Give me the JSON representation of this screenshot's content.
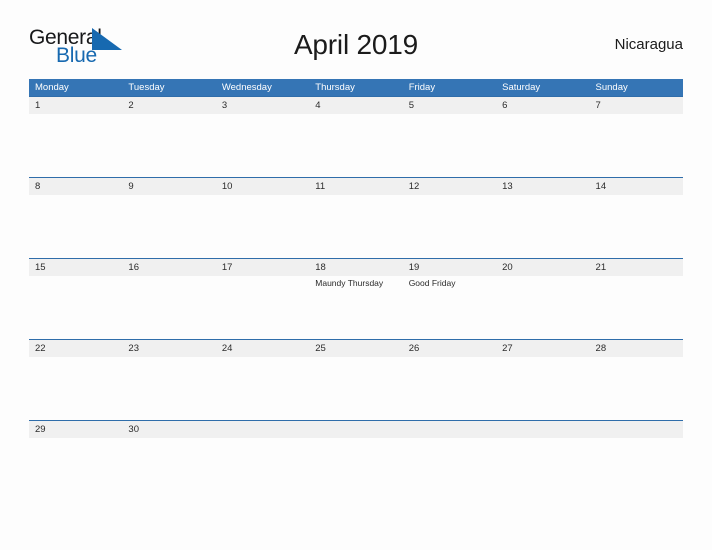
{
  "logo": {
    "word_one": "General",
    "word_two": "Blue",
    "triangle_icon": "triangle-icon",
    "blue": "#1769b0"
  },
  "header": {
    "title": "April 2019",
    "country": "Nicaragua"
  },
  "colors": {
    "header_blue": "#3575b5",
    "row_border_blue": "#2f6daa",
    "day_band_gray": "#f0f0f0",
    "page_background": "#fdfdfd",
    "text": "#2b2b2b"
  },
  "calendar": {
    "weekdays": [
      "Monday",
      "Tuesday",
      "Wednesday",
      "Thursday",
      "Friday",
      "Saturday",
      "Sunday"
    ],
    "weeks": [
      {
        "size": "tall",
        "days": [
          {
            "num": "1",
            "events": []
          },
          {
            "num": "2",
            "events": []
          },
          {
            "num": "3",
            "events": []
          },
          {
            "num": "4",
            "events": []
          },
          {
            "num": "5",
            "events": []
          },
          {
            "num": "6",
            "events": []
          },
          {
            "num": "7",
            "events": []
          }
        ]
      },
      {
        "size": "tall",
        "days": [
          {
            "num": "8",
            "events": []
          },
          {
            "num": "9",
            "events": []
          },
          {
            "num": "10",
            "events": []
          },
          {
            "num": "11",
            "events": []
          },
          {
            "num": "12",
            "events": []
          },
          {
            "num": "13",
            "events": []
          },
          {
            "num": "14",
            "events": []
          }
        ]
      },
      {
        "size": "tall",
        "days": [
          {
            "num": "15",
            "events": []
          },
          {
            "num": "16",
            "events": []
          },
          {
            "num": "17",
            "events": []
          },
          {
            "num": "18",
            "events": [
              "Maundy Thursday"
            ]
          },
          {
            "num": "19",
            "events": [
              "Good Friday"
            ]
          },
          {
            "num": "20",
            "events": []
          },
          {
            "num": "21",
            "events": []
          }
        ]
      },
      {
        "size": "tall",
        "days": [
          {
            "num": "22",
            "events": []
          },
          {
            "num": "23",
            "events": []
          },
          {
            "num": "24",
            "events": []
          },
          {
            "num": "25",
            "events": []
          },
          {
            "num": "26",
            "events": []
          },
          {
            "num": "27",
            "events": []
          },
          {
            "num": "28",
            "events": []
          }
        ]
      },
      {
        "size": "short",
        "days": [
          {
            "num": "29",
            "events": []
          },
          {
            "num": "30",
            "events": []
          },
          {
            "num": "",
            "events": []
          },
          {
            "num": "",
            "events": []
          },
          {
            "num": "",
            "events": []
          },
          {
            "num": "",
            "events": []
          },
          {
            "num": "",
            "events": []
          }
        ]
      }
    ]
  }
}
